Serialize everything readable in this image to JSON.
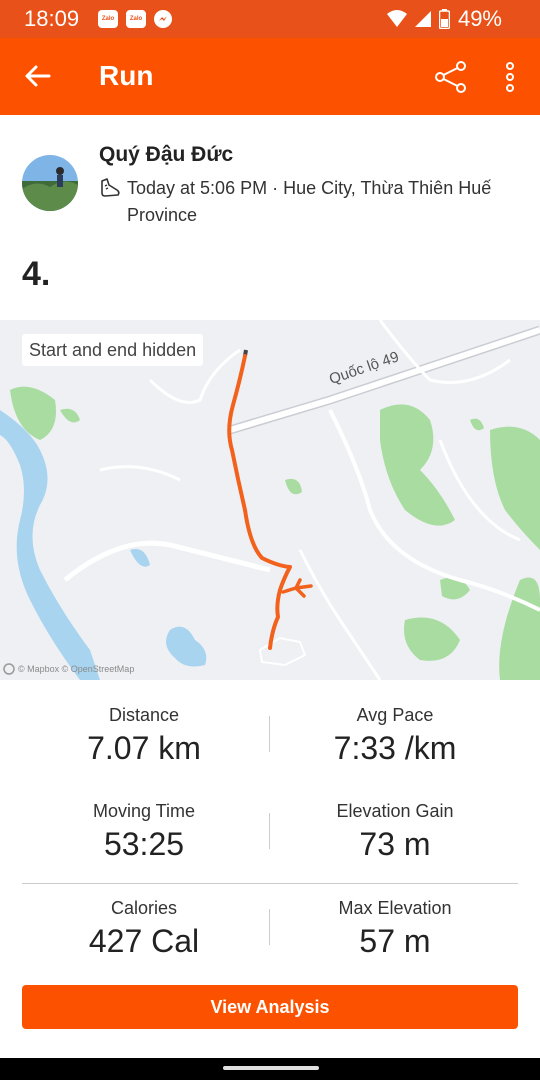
{
  "status_bar": {
    "time": "18:09",
    "app_icons": [
      {
        "name": "zalo-icon",
        "text": "Zalo"
      },
      {
        "name": "zalo-icon",
        "text": "Zalo"
      },
      {
        "name": "messenger-icon"
      }
    ],
    "battery": "49%"
  },
  "app_bar": {
    "title": "Run",
    "back_icon": "arrow-left",
    "share_icon": "share",
    "more_icon": "more-vertical"
  },
  "activity": {
    "athlete_name": "Quý Đậu Đức",
    "meta": "Today at 5:06 PM · Hue City, Thừa Thiên Huế Province",
    "title": "4."
  },
  "map": {
    "privacy_label": "Start and end hidden",
    "road_label": "Quốc lộ 49",
    "attribution": "© Mapbox © OpenStreetMap"
  },
  "stats": [
    {
      "label": "Distance",
      "value": "7.07 km"
    },
    {
      "label": "Avg Pace",
      "value": "7:33 /km"
    },
    {
      "label": "Moving Time",
      "value": "53:25"
    },
    {
      "label": "Elevation Gain",
      "value": "73 m"
    },
    {
      "label": "Calories",
      "value": "427 Cal"
    },
    {
      "label": "Max Elevation",
      "value": "57 m"
    }
  ],
  "actions": {
    "view_analysis": "View Analysis"
  },
  "colors": {
    "brand": "#fc5200",
    "status_bar": "#e8521a",
    "route": "#f2621c",
    "water": "#a8d4f0",
    "park": "#a9dca0"
  }
}
